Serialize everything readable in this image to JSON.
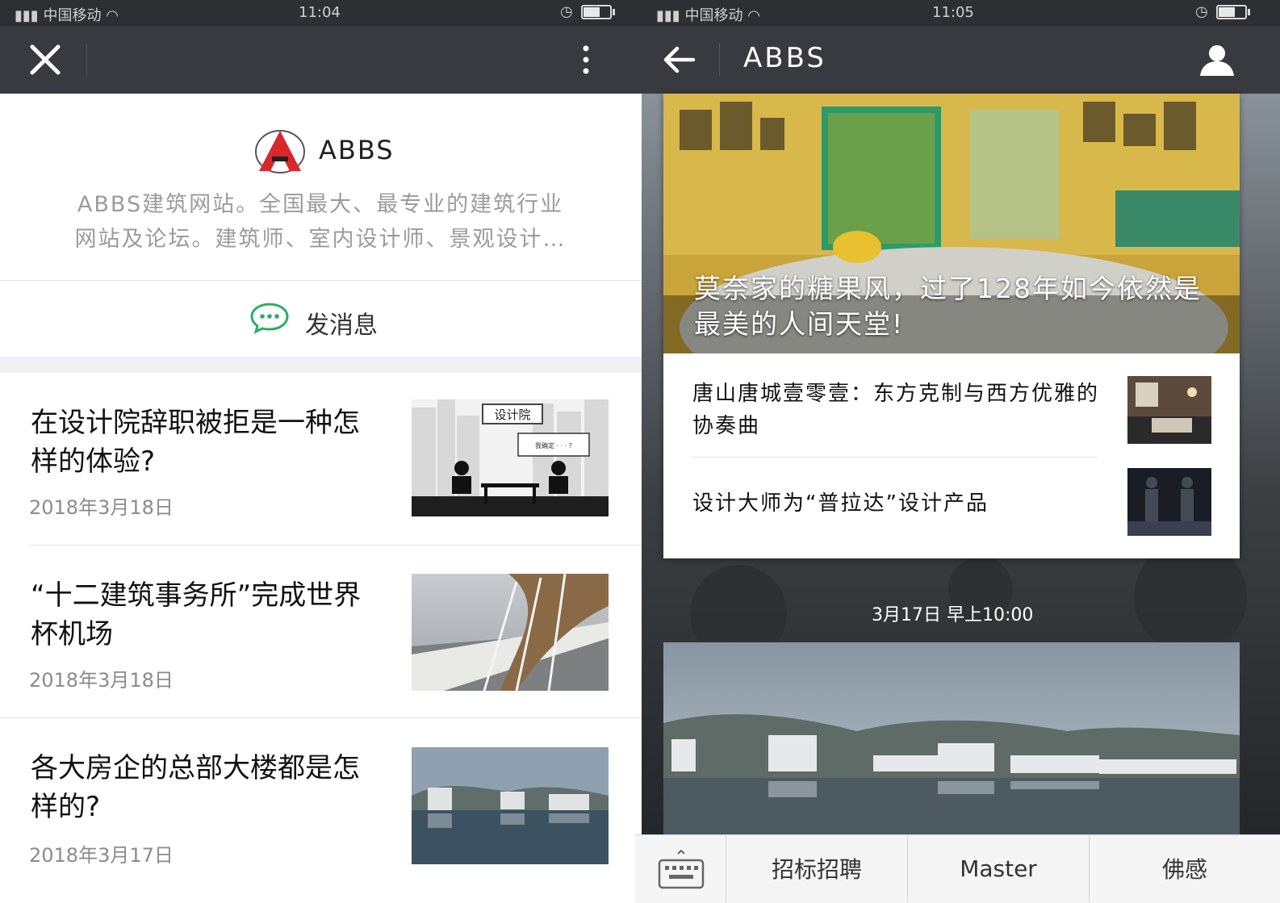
{
  "left": {
    "status": {
      "carrier": "中国移动",
      "time": "11:04"
    },
    "profile": {
      "name": "ABBS",
      "description_line1": "ABBS建筑网站。全国最大、最专业的建筑行业",
      "description_line2": "网站及论坛。建筑师、室内设计师、景观设计…"
    },
    "message_button": "发消息",
    "articles": [
      {
        "title": "在设计院辞职被拒是一种怎样的体验?",
        "date": "2018年3月18日",
        "image_text": "设计院"
      },
      {
        "title": "“十二建筑事务所”完成世界杯机场",
        "date": "2018年3月18日"
      },
      {
        "title": "各大房企的总部大楼都是怎样的?",
        "date": "2018年3月17日"
      }
    ]
  },
  "right": {
    "status": {
      "carrier": "中国移动",
      "time": "11:05"
    },
    "title": "ABBS",
    "hero_caption": "莫奈家的糖果风，过了128年如今依然是最美的人间天堂!",
    "sub_articles": [
      {
        "title": "唐山唐城壹零壹：东方克制与西方优雅的协奏曲"
      },
      {
        "title": "设计大师为“普拉达”设计产品"
      }
    ],
    "timestamp": "3月17日 早上10:00",
    "tabs": [
      "招标招聘",
      "Master",
      "佛感"
    ]
  }
}
